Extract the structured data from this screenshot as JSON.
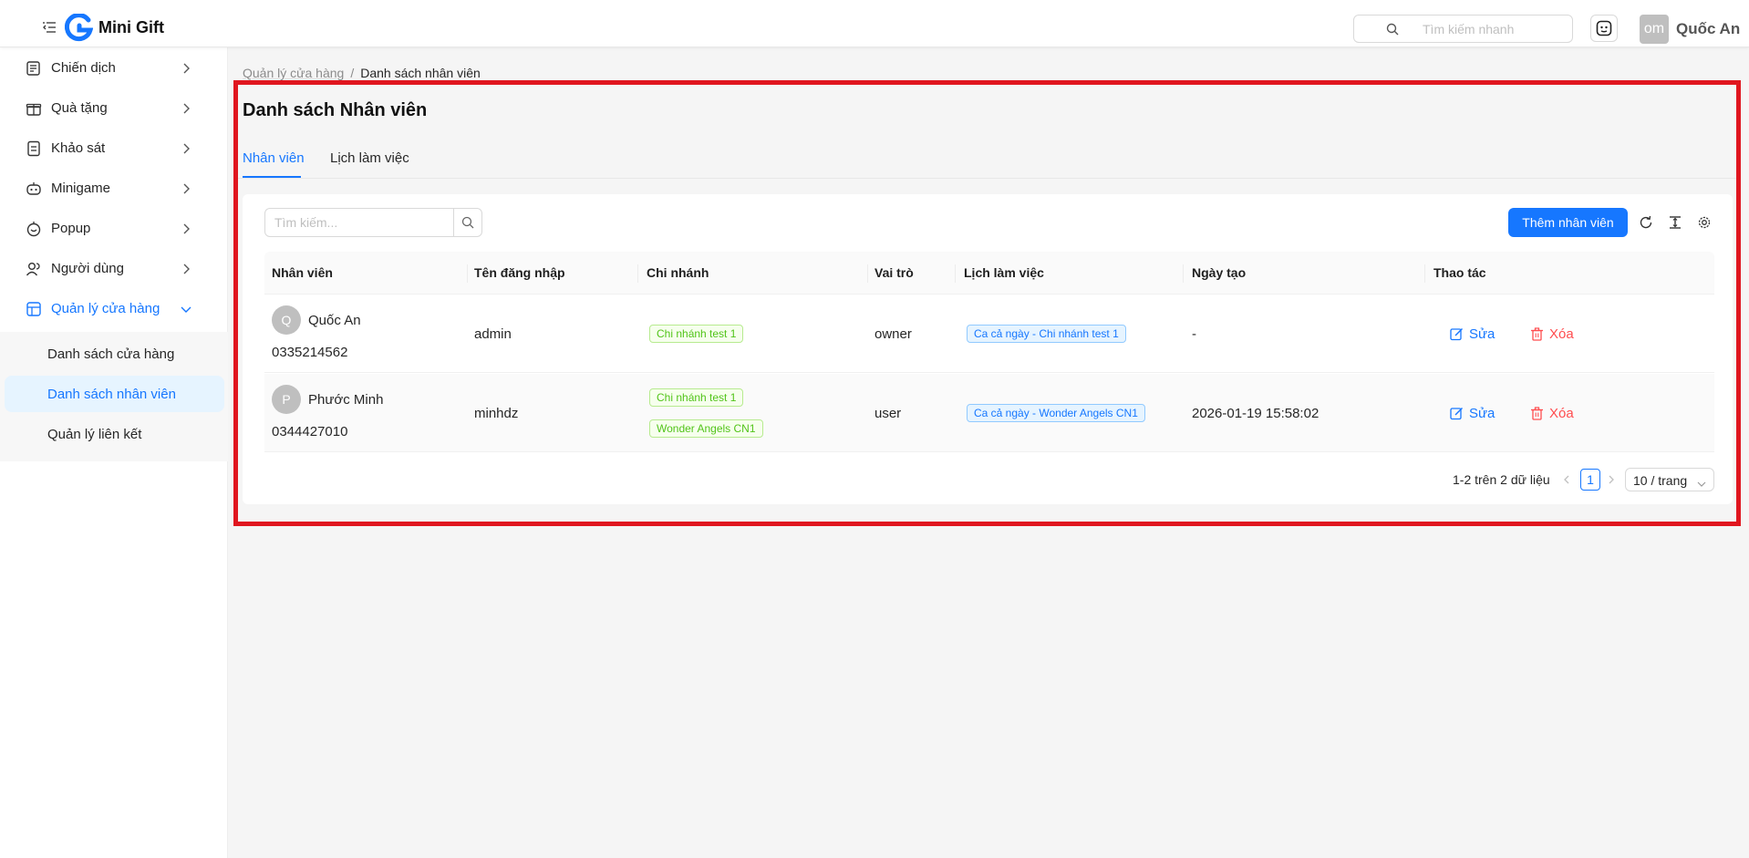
{
  "app": {
    "name": "Mini Gift"
  },
  "header": {
    "search_placeholder": "Tìm kiếm nhanh",
    "user_initials": "om",
    "user_name": "Quốc An"
  },
  "sidebar": {
    "items": [
      {
        "label": "Chiến dịch",
        "icon": "campaign-icon"
      },
      {
        "label": "Quà tặng",
        "icon": "gift-icon"
      },
      {
        "label": "Khảo sát",
        "icon": "survey-icon"
      },
      {
        "label": "Minigame",
        "icon": "robot-icon"
      },
      {
        "label": "Popup",
        "icon": "popup-icon"
      },
      {
        "label": "Người dùng",
        "icon": "users-icon"
      },
      {
        "label": "Quản lý cửa hàng",
        "icon": "store-icon",
        "active": true
      }
    ],
    "subitems": [
      {
        "label": "Danh sách cửa hàng"
      },
      {
        "label": "Danh sách nhân viên",
        "selected": true
      },
      {
        "label": "Quản lý liên kết"
      }
    ]
  },
  "breadcrumb": {
    "parent": "Quản lý cửa hàng",
    "separator": "/",
    "current": "Danh sách nhân viên"
  },
  "page": {
    "title": "Danh sách Nhân viên",
    "tabs": [
      {
        "label": "Nhân viên",
        "active": true
      },
      {
        "label": "Lịch làm việc"
      }
    ]
  },
  "toolbar": {
    "search_placeholder": "Tìm kiếm...",
    "add_label": "Thêm nhân viên"
  },
  "table": {
    "columns": [
      "Nhân viên",
      "Tên đăng nhập",
      "Chi nhánh",
      "Vai trò",
      "Lịch làm việc",
      "Ngày tạo",
      "Thao tác"
    ],
    "edit_label": "Sửa",
    "delete_label": "Xóa",
    "rows": [
      {
        "initial": "Q",
        "name": "Quốc An",
        "phone": "0335214562",
        "username": "admin",
        "branches": [
          "Chi nhánh test 1"
        ],
        "role": "owner",
        "schedule": "Ca cả ngày - Chi nhánh test 1",
        "created": "-"
      },
      {
        "initial": "P",
        "name": "Phước Minh",
        "phone": "0344427010",
        "username": "minhdz",
        "branches": [
          "Chi nhánh test 1",
          "Wonder Angels CN1"
        ],
        "role": "user",
        "schedule": "Ca cả ngày - Wonder Angels CN1",
        "created": "2026-01-19 15:58:02"
      }
    ]
  },
  "pagination": {
    "total_text": "1-2 trên 2 dữ liệu",
    "current_page": "1",
    "page_size": "10 / trang"
  },
  "colors": {
    "primary": "#1677ff",
    "danger": "#ff4d4f",
    "success": "#52c41a",
    "highlight_frame": "#e0161f"
  }
}
